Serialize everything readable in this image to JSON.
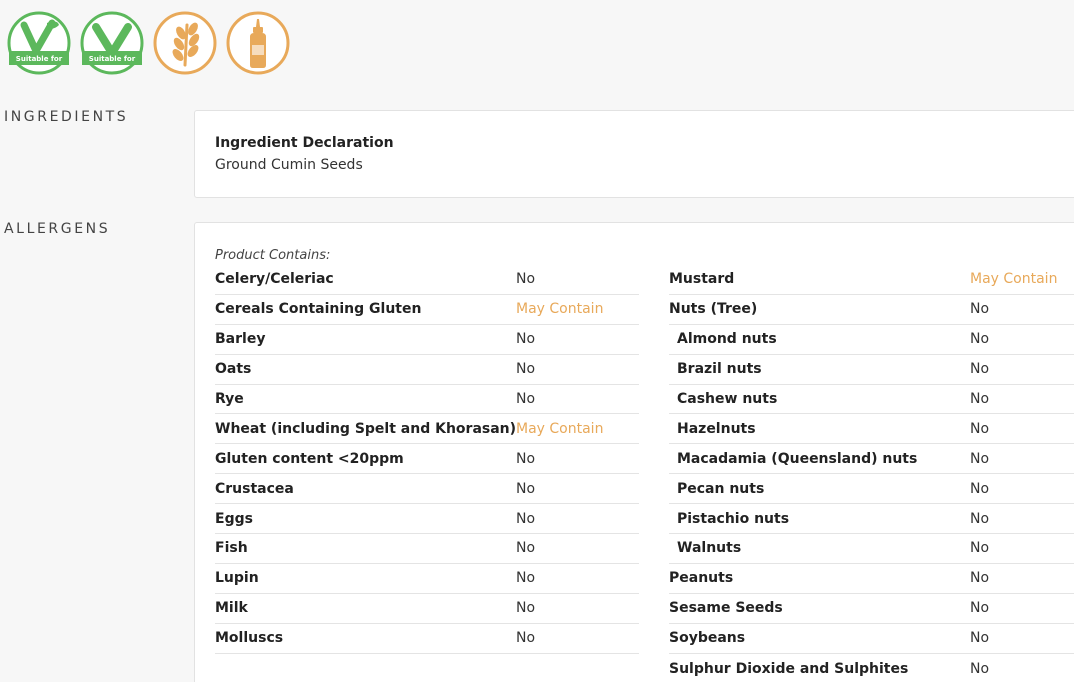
{
  "badges": [
    {
      "icon": "vegan-icon",
      "caption": "Suitable for",
      "color": "#5cb85c"
    },
    {
      "icon": "vegetarian-icon",
      "caption": "Suitable for",
      "color": "#5cb85c"
    },
    {
      "icon": "gluten-wheat-icon",
      "color": "#e8a95a"
    },
    {
      "icon": "mustard-bottle-icon",
      "color": "#e8a95a"
    }
  ],
  "ingredients": {
    "label": "INGREDIENTS",
    "declaration_title": "Ingredient Declaration",
    "declaration_text": "Ground Cumin Seeds"
  },
  "allergens": {
    "label": "ALLERGENS",
    "product_contains": "Product Contains:",
    "left": [
      {
        "name": "Celery/Celeriac",
        "value": "No"
      },
      {
        "name": "Cereals Containing Gluten",
        "value": "May Contain"
      },
      {
        "name": "Barley",
        "value": "No"
      },
      {
        "name": "Oats",
        "value": "No"
      },
      {
        "name": "Rye",
        "value": "No"
      },
      {
        "name": "Wheat (including Spelt and Khorasan)",
        "value": "May Contain"
      },
      {
        "name": "Gluten content <20ppm",
        "value": "No"
      },
      {
        "name": "Crustacea",
        "value": "No"
      },
      {
        "name": "Eggs",
        "value": "No"
      },
      {
        "name": "Fish",
        "value": "No"
      },
      {
        "name": "Lupin",
        "value": "No"
      },
      {
        "name": "Milk",
        "value": "No"
      },
      {
        "name": "Molluscs",
        "value": "No"
      }
    ],
    "right": [
      {
        "name": "Mustard",
        "value": "May Contain",
        "sub": false
      },
      {
        "name": "Nuts (Tree)",
        "value": "No",
        "sub": false
      },
      {
        "name": "Almond nuts",
        "value": "No",
        "sub": true
      },
      {
        "name": "Brazil nuts",
        "value": "No",
        "sub": true
      },
      {
        "name": "Cashew nuts",
        "value": "No",
        "sub": true
      },
      {
        "name": "Hazelnuts",
        "value": "No",
        "sub": true
      },
      {
        "name": "Macadamia (Queensland) nuts",
        "value": "No",
        "sub": true
      },
      {
        "name": "Pecan nuts",
        "value": "No",
        "sub": true
      },
      {
        "name": "Pistachio nuts",
        "value": "No",
        "sub": true
      },
      {
        "name": "Walnuts",
        "value": "No",
        "sub": true
      },
      {
        "name": "Peanuts",
        "value": "No",
        "sub": false
      },
      {
        "name": "Sesame Seeds",
        "value": "No",
        "sub": false
      },
      {
        "name": "Soybeans",
        "value": "No",
        "sub": false
      },
      {
        "name": "Sulphur Dioxide and Sulphites",
        "value": "No",
        "sub": false
      }
    ]
  },
  "colors": {
    "may_contain": "#e8a95a",
    "suitable_green": "#5cb85c"
  }
}
